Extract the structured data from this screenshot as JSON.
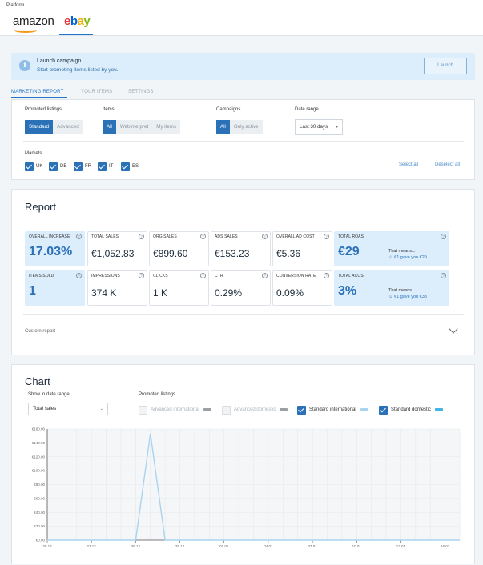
{
  "platform": {
    "label": "Platform",
    "tabs": [
      "amazon",
      "ebay"
    ],
    "active": "ebay"
  },
  "banner": {
    "icon": "info-icon",
    "title": "Launch campaign",
    "subtitle": "Start promoting items listed by you.",
    "button": "Launch"
  },
  "subtabs": [
    "MARKETING REPORT",
    "YOUR ITEMS",
    "SETTINGS"
  ],
  "filters": {
    "promoted_label": "Promoted listings",
    "promoted_options": [
      "Standard",
      "Advanced"
    ],
    "promoted_selected": "Standard",
    "items_label": "Items",
    "items_options": [
      "All",
      "Webinterpret",
      "My items"
    ],
    "items_selected": "All",
    "campaigns_label": "Campaigns",
    "campaigns_options": [
      "All",
      "Only active"
    ],
    "campaigns_selected": "All",
    "date_label": "Date range",
    "date_value": "Last 30 days",
    "markets_label": "Markets",
    "markets": [
      "UK",
      "DE",
      "FR",
      "IT",
      "ES"
    ],
    "select_all": "Select all",
    "deselect_all": "Deselect all"
  },
  "report": {
    "title": "Report",
    "cards_row1": [
      {
        "label": "OVERALL INCREASE",
        "value": "17.03%"
      },
      {
        "label": "TOTAL SALES",
        "value": "€1,052.83"
      },
      {
        "label": "ORG SALES",
        "value": "€899.60"
      },
      {
        "label": "ADS SALES",
        "value": "€153.23"
      },
      {
        "label": "OVERALL AD COST",
        "value": "€5.36"
      },
      {
        "label": "TOTAL ROAS",
        "value": "€29",
        "means": "That means...",
        "means_detail": "€1 gave you €29"
      }
    ],
    "cards_row2": [
      {
        "label": "ITEMS SOLD",
        "value": "1"
      },
      {
        "label": "IMPRESSIONS",
        "value": "374 K"
      },
      {
        "label": "CLICKS",
        "value": "1 K"
      },
      {
        "label": "CTR",
        "value": "0.29%"
      },
      {
        "label": "CONVERSION RATE",
        "value": "0.09%"
      },
      {
        "label": "TOTAL ACOS",
        "value": "3%",
        "means": "That means...",
        "means_detail": "€1 gave you €33"
      }
    ],
    "custom_report": "Custom report"
  },
  "chart": {
    "title": "Chart",
    "range_label": "Show in date range",
    "range_value": "Total sales",
    "promoted_label": "Promoted listings",
    "legend": [
      {
        "name": "Advanced international",
        "checked": false,
        "color": "#9aa0a6"
      },
      {
        "name": "Advanced domestic",
        "checked": false,
        "color": "#9aa0a6"
      },
      {
        "name": "Standard international",
        "checked": true,
        "color": "#a8d4f0"
      },
      {
        "name": "Standard domestic",
        "checked": true,
        "color": "#43b5e6"
      }
    ]
  },
  "chart_data": {
    "type": "line",
    "x": [
      "20.12",
      "21.12",
      "22.12",
      "23.12",
      "24.12",
      "25.12",
      "26.12",
      "27.12",
      "28.12",
      "29.12",
      "30.12",
      "31.12",
      "01.01",
      "02.01",
      "03.01",
      "04.01",
      "05.01",
      "06.01",
      "07.01",
      "08.01",
      "09.01",
      "10.01",
      "11.01",
      "12.01",
      "13.01",
      "14.01",
      "15.01",
      "16.01",
      "17.01"
    ],
    "xticks": [
      "20.12",
      "23.12",
      "26.12",
      "29.12",
      "01.01",
      "04.01",
      "07.01",
      "10.01",
      "13.01",
      "16.01"
    ],
    "yticks": [
      "€0.00",
      "€20.00",
      "€40.00",
      "€60.00",
      "€80.00",
      "€100.00",
      "€120.00",
      "€140.00",
      "€160.00"
    ],
    "ylim": [
      0,
      160
    ],
    "series": [
      {
        "name": "Standard international",
        "color": "#a8d4f0",
        "values": [
          0,
          0,
          0,
          0,
          0,
          0,
          0,
          153.23,
          0,
          0,
          0,
          0,
          0,
          0,
          0,
          0,
          0,
          0,
          0,
          0,
          0,
          0,
          0,
          0,
          0,
          0,
          0,
          0,
          0
        ]
      }
    ]
  }
}
